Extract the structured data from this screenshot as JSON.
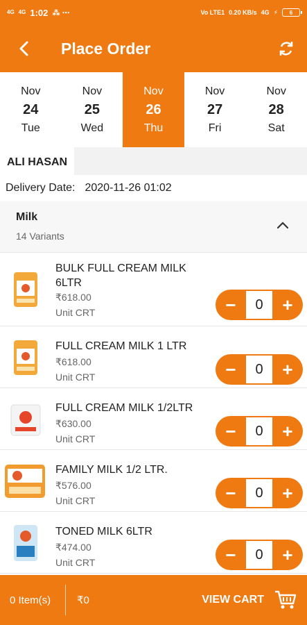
{
  "status_bar": {
    "time": "1:02",
    "signal_left": "4G",
    "extra": "Vo LTE1",
    "speed": "0.20 KB/s",
    "network": "4G",
    "battery": "6"
  },
  "header": {
    "title": "Place Order",
    "back_icon": "back-arrow-icon",
    "refresh_icon": "refresh-icon"
  },
  "dates": [
    {
      "month": "Nov",
      "day": "24",
      "weekday": "Tue",
      "selected": false
    },
    {
      "month": "Nov",
      "day": "25",
      "weekday": "Wed",
      "selected": false
    },
    {
      "month": "Nov",
      "day": "26",
      "weekday": "Thu",
      "selected": true
    },
    {
      "month": "Nov",
      "day": "27",
      "weekday": "Fri",
      "selected": false
    },
    {
      "month": "Nov",
      "day": "28",
      "weekday": "Sat",
      "selected": false
    }
  ],
  "customer": {
    "name": "ALI HASAN"
  },
  "delivery": {
    "label": "Delivery Date:",
    "value": "2020-11-26 01:02"
  },
  "category": {
    "name": "Milk",
    "variants": "14 Variants"
  },
  "products": [
    {
      "name": "BULK FULL CREAM MILK 6LTR",
      "price": "₹618.00",
      "unit": "Unit CRT",
      "qty": "0",
      "image": "milk-pouch-yellow"
    },
    {
      "name": "FULL CREAM MILK 1 LTR",
      "price": "₹618.00",
      "unit": "Unit CRT",
      "qty": "0",
      "image": "milk-pouch-yellow"
    },
    {
      "name": "FULL CREAM MILK 1/2LTR",
      "price": "₹630.00",
      "unit": "Unit CRT",
      "qty": "0",
      "image": "milk-pouch-white"
    },
    {
      "name": "FAMILY MILK 1/2 LTR.",
      "price": "₹576.00",
      "unit": "Unit CRT",
      "qty": "0",
      "image": "milk-pouch-orange"
    },
    {
      "name": "TONED MILK 6LTR",
      "price": "₹474.00",
      "unit": "Unit CRT",
      "qty": "0",
      "image": "milk-pouch-blue"
    }
  ],
  "cart": {
    "items": "0 Item(s)",
    "total": "₹0",
    "view_cart": "VIEW CART",
    "cart_icon": "cart-icon"
  },
  "colors": {
    "accent": "#f07a12"
  }
}
